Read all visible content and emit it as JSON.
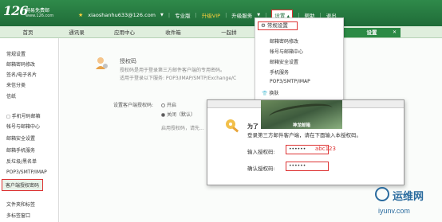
{
  "header": {
    "logo_number": "126",
    "logo_name": "网易免费邮",
    "logo_url": "www.126.com",
    "user_email": "xiaoshanhu633@126.com",
    "links": [
      "专业版",
      "升级VIP",
      "升级服务",
      "设置",
      "帮助",
      "退出"
    ]
  },
  "tabs": [
    {
      "label": "首页"
    },
    {
      "label": "通讯录"
    },
    {
      "label": "应用中心"
    },
    {
      "label": "收件箱"
    },
    {
      "label": "一起拼"
    },
    {
      "label": "设置"
    }
  ],
  "tab_close": "✕",
  "sidebar": {
    "items": [
      "常规设置",
      "邮箱密码修改",
      "签名/电子名片",
      "来信分类",
      "信纸",
      "手机号码邮箱",
      "帐号与邮箱中心",
      "邮箱安全设置",
      "邮箱手机服务",
      "反垃圾/黑名单",
      "POP3/SMTP/IMAP",
      "客户端授权密码",
      "文件夹和标签",
      "多标签窗口"
    ]
  },
  "main": {
    "auth_title": "授权码",
    "auth_desc1": "授权码是用于登录第三方邮件客户端的专用密码。",
    "auth_desc2": "适用于登录以下服务: POP3/IMAP/SMTP/Exchange/C",
    "client_label": "设置客户端授权码:",
    "radio_on": "开启",
    "radio_off": "关闭（默认）",
    "hint": "启用授权码，请先..."
  },
  "dropdown": {
    "header": "常规设置",
    "items": [
      "邮箱密码修改",
      "帐号与邮箱中心",
      "邮箱安全设置",
      "手机服务",
      "POP3/SMTP/IMAP",
      "换肤"
    ]
  },
  "modal": {
    "heading": "为了",
    "desc": "登录第三方邮件客户端，请在下面输入本授权码。",
    "image_caption": "神龙邮箱",
    "label_input": "输入授权码:",
    "label_confirm": "确认授权码:",
    "input_value": "••••••",
    "confirm_value": "••••••",
    "annotation": "abc123"
  },
  "watermark": {
    "name": "运维网",
    "url": "iyunv.com"
  },
  "colors": {
    "brand_green": "#2c8a45",
    "highlight_red": "#dd3333"
  }
}
